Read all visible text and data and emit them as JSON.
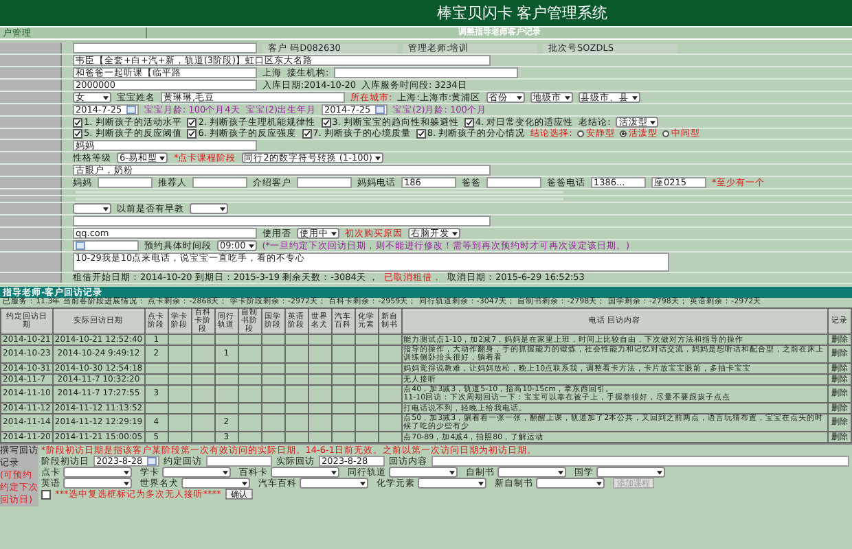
{
  "header": {
    "title": "棒宝贝闪卡 客户管理系统"
  },
  "tab_bar": {
    "left": "户管理",
    "center": "调整指导老师客户记录"
  },
  "form": {
    "rows": [
      {
        "kind": "fields",
        "parts": [
          {
            "kind": "field"
          },
          {
            "kind": "cell",
            "text": "客户 码D082630"
          },
          {
            "kind": "cell",
            "text": "管理老师:培训"
          },
          {
            "kind": "cell",
            "text": "批次号SOZDLS"
          }
        ]
      },
      {
        "kind": "fields",
        "parts": [
          {
            "kind": "widefield",
            "value": "韦臣【全套+白+汽+新，轨道(3阶段)】虹口区东大名路"
          }
        ]
      },
      {
        "kind": "fields",
        "parts": [
          {
            "kind": "field",
            "value": "和爸爸一起听课【临平路"
          },
          {
            "kind": "label",
            "text": "上海"
          },
          {
            "kind": "label",
            "text": "接生机构:"
          },
          {
            "kind": "field"
          }
        ]
      },
      {
        "kind": "fields",
        "parts": [
          {
            "kind": "field",
            "value": "2000000"
          },
          {
            "kind": "label",
            "text": "入库日期:2014-10-20"
          },
          {
            "kind": "label",
            "text": "入库服务时间段: 3234日"
          }
        ]
      },
      {
        "kind": "fields",
        "parts": [
          {
            "kind": "select",
            "value": "女"
          },
          {
            "kind": "label",
            "text": "宝宝姓名"
          },
          {
            "kind": "field",
            "value": "黄琳琳,毛豆"
          },
          {
            "kind": "alert",
            "text": "所在城市:"
          },
          {
            "kind": "label",
            "text": "上海:上海市:黄浦区"
          },
          {
            "kind": "select",
            "value": "省份"
          },
          {
            "kind": "select",
            "value": "地级市"
          },
          {
            "kind": "select",
            "value": "县级市、县"
          }
        ]
      },
      {
        "kind": "fields",
        "parts": [
          {
            "kind": "datefield",
            "value": "2014-7-25"
          },
          {
            "kind": "hint",
            "text": "宝宝月龄: 100个月4天"
          },
          {
            "kind": "hint",
            "text": "宝宝(2)出生年月"
          },
          {
            "kind": "datefield",
            "value": "2014-7-25"
          },
          {
            "kind": "hint",
            "text": "宝宝(2)月龄: 100个月"
          }
        ]
      },
      {
        "kind": "fields",
        "parts": [
          {
            "kind": "checkbox",
            "label": "1. 判断孩子的活动水平",
            "checked": true
          },
          {
            "kind": "checkbox",
            "label": "2. 判断孩子生理机能规律性",
            "checked": true
          },
          {
            "kind": "checkbox",
            "label": "3. 判断宝宝的趋向性和躲避性",
            "checked": true
          },
          {
            "kind": "checkbox",
            "label": "4. 对日常变化的适应性",
            "checked": true
          },
          {
            "kind": "label",
            "text": "老结论:"
          },
          {
            "kind": "select",
            "value": "活泼型"
          }
        ]
      },
      {
        "kind": "fields",
        "parts": [
          {
            "kind": "checkbox",
            "label": "5. 判断孩子的反应阈值",
            "checked": true
          },
          {
            "kind": "checkbox",
            "label": "6. 判断孩子的反应强度",
            "checked": true
          },
          {
            "kind": "checkbox",
            "label": "7. 判断孩子的心境质量",
            "checked": true
          },
          {
            "kind": "checkbox",
            "label": "8. 判断孩子的分心情况",
            "checked": true
          },
          {
            "kind": "alert",
            "text": "结论选择:"
          },
          {
            "kind": "radio",
            "label": "安静型",
            "selected": false
          },
          {
            "kind": "radio",
            "label": "活泼型",
            "selected": true
          },
          {
            "kind": "radio",
            "label": "中间型",
            "selected": false
          }
        ]
      },
      {
        "kind": "fields",
        "parts": [
          {
            "kind": "field",
            "value": "妈妈"
          }
        ]
      },
      {
        "kind": "fields",
        "parts": [
          {
            "kind": "label",
            "text": "性格等级"
          },
          {
            "kind": "select",
            "value": "6-易和型"
          },
          {
            "kind": "alert",
            "text": "*点卡课程阶段"
          },
          {
            "kind": "select",
            "value": "同行2的数字符号转换 (1-100)"
          }
        ]
      },
      {
        "kind": "fields",
        "parts": [
          {
            "kind": "widefield",
            "value": "古眼户，奶粉"
          }
        ]
      },
      {
        "kind": "fields",
        "parts": [
          {
            "kind": "label",
            "text": "妈妈"
          },
          {
            "kind": "shortfield"
          },
          {
            "kind": "label",
            "text": "推荐人"
          },
          {
            "kind": "shortfield"
          },
          {
            "kind": "label",
            "text": "介绍客户"
          },
          {
            "kind": "shortfield"
          },
          {
            "kind": "label",
            "text": "妈妈电话"
          },
          {
            "kind": "shortfield",
            "value": "186"
          },
          {
            "kind": "label",
            "text": "爸爸"
          },
          {
            "kind": "shortfield"
          },
          {
            "kind": "label",
            "text": "爸爸电话"
          },
          {
            "kind": "shortfield",
            "value": "1386..."
          },
          {
            "kind": "shortfield",
            "value": "座0215"
          },
          {
            "kind": "alert",
            "text": "*至少有一个"
          }
        ]
      },
      {
        "kind": "spacer"
      },
      {
        "kind": "spacer"
      },
      {
        "kind": "fields",
        "parts": [
          {
            "kind": "select"
          },
          {
            "kind": "label",
            "text": "以前是否有早教"
          },
          {
            "kind": "select"
          }
        ]
      },
      {
        "kind": "fields",
        "parts": [
          {
            "kind": "widefield"
          }
        ]
      },
      {
        "kind": "fields",
        "parts": [
          {
            "kind": "field",
            "value": "qq.com"
          },
          {
            "kind": "label",
            "text": "使用否"
          },
          {
            "kind": "select",
            "value": "使用中"
          },
          {
            "kind": "alert",
            "text": "初次购买原因"
          },
          {
            "kind": "select",
            "value": "右脑开发"
          }
        ]
      },
      {
        "kind": "fields",
        "parts": [
          {
            "kind": "datefield"
          },
          {
            "kind": "label",
            "text": "预约具体时间段"
          },
          {
            "kind": "select",
            "value": "09:00"
          },
          {
            "kind": "hint",
            "text": "(*一旦约定下次回访日期，则不能进行修改！需等到再次预约时才可再次设定该日期。)"
          }
        ]
      },
      {
        "kind": "fields",
        "parts": [
          {
            "kind": "textarea",
            "value": "10-29我是10点来电话，说宝宝一直吃手，看的不专心"
          }
        ]
      },
      {
        "kind": "fields",
        "parts": [
          {
            "kind": "label",
            "text": "租借开始日期：2014-10-20 到期日：2015-3-19 剩余天数：-3084天 ，"
          },
          {
            "kind": "alert",
            "text": "已取消租借，"
          },
          {
            "kind": "label",
            "text": "取消日期：2015-6-29 16:52:53"
          }
        ]
      }
    ]
  },
  "visits": {
    "title": "指导老师-客户回访记录",
    "summary": "已服务：11.3年 当前各阶段进展情况：  点卡剩余：-2868天； 学卡阶段剩余：-2972天； 百科卡剩余：-2959天； 同行轨道剩余：-3047天； 自制书剩余：-2798天； 国学剩余：-2798天； 英语剩余：-2972天",
    "columns": [
      "约定回访日期",
      "实际回访日期",
      "点卡阶段",
      "学卡阶段",
      "百科卡阶段",
      "同行轨道",
      "自制书阶段",
      "国学阶段",
      "英语阶段",
      "世界名犬",
      "汽车百科",
      "化学元素",
      "新自制书",
      "电话 回访内容",
      "记录"
    ],
    "rows": [
      {
        "planned": "2014-10-21",
        "actual": "2014-10-21 12:52:40",
        "card_stage": "1",
        "content": [
          "能力测试点1-10，加2减7，妈妈是在家里上班，时间上比较自由，下次做对方法和指导的操作"
        ],
        "action": "删除"
      },
      {
        "planned": "2014-10-23",
        "actual": "2014-10-24 9:49:12",
        "card_stage": "2",
        "track_stage": "1",
        "content": [
          "指导的操作，大动作翻身，手的抓握能力的锻炼，社会性能力和记忆对话交流，妈妈是想听话和配合型，之前在床上训练侧卧抬头很好，躺着看"
        ],
        "action": "删除"
      },
      {
        "planned": "2014-10-31",
        "actual": "2014-10-30 12:54:18",
        "content": [
          "妈妈觉得说教难，让妈妈放松，晚上10点联系我，调整看卡方法，卡片放宝宝眼前，多抽卡宝宝"
        ],
        "action": "删除"
      },
      {
        "planned": "2014-11-7",
        "actual": "2014-11-7 10:32:20",
        "content": [
          "无人接听"
        ],
        "action": "删除"
      },
      {
        "planned": "2014-11-10",
        "actual": "2014-11-7 17:27:55",
        "card_stage": "3",
        "content": [
          "点40，加3减3，轨道5-10，抬高10-15cm，拿东西回引。",
          "11-10回访：下次周期回访一下：宝宝可以靠在被子上，手握拳很好，尽量不要跟孩子点点"
        ],
        "action": "删除"
      },
      {
        "planned": "2014-11-12",
        "actual": "2014-11-12 11:13:52",
        "content": [
          "打电话说不到，轻晚上给我电话。"
        ],
        "action": "删除"
      },
      {
        "planned": "2014-11-14",
        "actual": "2014-11-12 12:29:19",
        "card_stage": "4",
        "track_stage": "2",
        "content": [
          "点50，加3减3，躺着看一张一张，翻醒上课，轨道加了2本公共，又回到之前两点，语言玩猜布置，宝宝在点头的时候了吃的少些有少"
        ],
        "action": "删除"
      },
      {
        "planned": "2014-11-20",
        "actual": "2014-11-21 15:00:05",
        "card_stage": "5",
        "track_stage": "3",
        "content": [
          "点70-89，加4减4，拍照80，了解运动"
        ],
        "action": "删除"
      }
    ]
  },
  "new_visit": {
    "title": "撰写回访记录",
    "subtitle": "(可预约约定下次回访日)",
    "notice": "*阶段初访日期是指该客户某阶段第一次有效访问的实际日期。14-6-1日前无效。之前以第一次访问日期为初访日期。",
    "dates": [
      {
        "label": "阶段初访日",
        "value": "2023-8-28",
        "kind": "date"
      },
      {
        "label": "约定回访",
        "kind": "plain"
      },
      {
        "label": "实际回访",
        "value": "2023-8-28",
        "kind": "plain"
      },
      {
        "label": "回访内容",
        "kind": "wide"
      }
    ],
    "selects": [
      [
        "点卡",
        "学卡",
        "百科卡",
        "同行轨道",
        "自制书",
        "国学"
      ],
      [
        "英语",
        "世界名犬",
        "汽车百科",
        "化学元素",
        "新自制书"
      ]
    ],
    "disabled_button": "添加课程",
    "repeat_checkbox": {
      "label": "***选中复选框标记为多次无人接听****",
      "checked": false
    },
    "confirm_button": "确认"
  }
}
